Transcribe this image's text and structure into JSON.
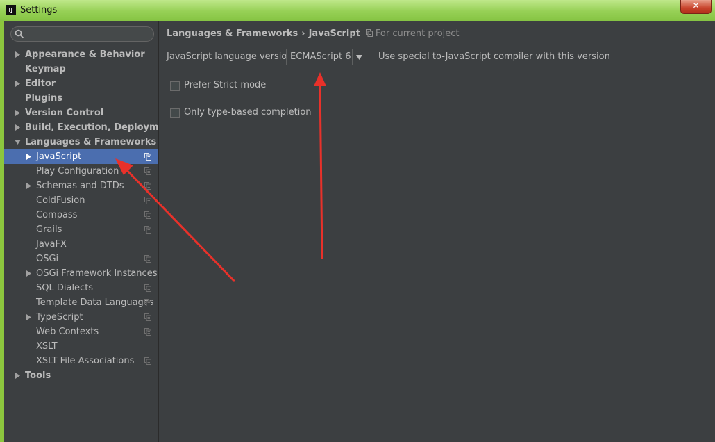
{
  "window": {
    "title": "Settings",
    "logo": "IJ",
    "close_glyph": "✕"
  },
  "search": {
    "placeholder": ""
  },
  "tree": {
    "appearance": "Appearance & Behavior",
    "keymap": "Keymap",
    "editor": "Editor",
    "plugins": "Plugins",
    "version_control": "Version Control",
    "build": "Build, Execution, Deployment",
    "languages": "Languages & Frameworks",
    "javascript": "JavaScript",
    "play": "Play Configuration",
    "schemas": "Schemas and DTDs",
    "coldfusion": "ColdFusion",
    "compass": "Compass",
    "grails": "Grails",
    "javafx": "JavaFX",
    "osgi": "OSGi",
    "osgi_instances": "OSGi Framework Instances",
    "sql": "SQL Dialects",
    "template": "Template Data Languages",
    "typescript": "TypeScript",
    "web": "Web Contexts",
    "xslt": "XSLT",
    "xslt_assoc": "XSLT File Associations",
    "tools": "Tools"
  },
  "breadcrumb": {
    "parent": "Languages & Frameworks",
    "separator": "›",
    "current": "JavaScript",
    "scope": "For current project"
  },
  "settings": {
    "version_label": "JavaScript language version",
    "version_value": "ECMAScript 6",
    "version_hint": "Use special to-JavaScript compiler with this version",
    "strict_label": "Prefer Strict mode",
    "strict_checked": false,
    "typebased_label": "Only type-based completion",
    "typebased_checked": false
  },
  "colors": {
    "background": "#3c3f41",
    "selection": "#4b6eaf",
    "text": "#bbbbbb",
    "annotation_arrow": "#e8312a",
    "window_frame": "#8cc63e"
  },
  "icons": {
    "search": "search-icon",
    "expand": "chevron-right-icon",
    "project_scope": "project-scope-icon",
    "dropdown": "chevron-down-icon"
  }
}
